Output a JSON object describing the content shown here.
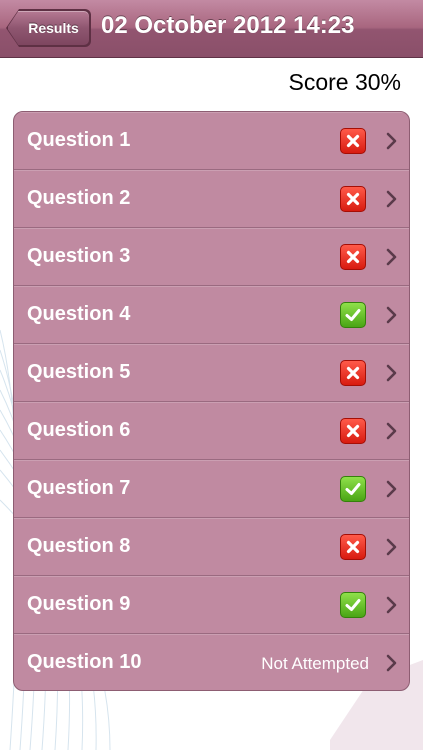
{
  "navbar": {
    "back_label": "Results",
    "title": "02 October 2012 14:23"
  },
  "score": {
    "text": "Score 30%"
  },
  "questions": [
    {
      "label": "Question 1",
      "status": "incorrect",
      "status_icon": "cross-icon",
      "status_text": ""
    },
    {
      "label": "Question 2",
      "status": "incorrect",
      "status_icon": "cross-icon",
      "status_text": ""
    },
    {
      "label": "Question 3",
      "status": "incorrect",
      "status_icon": "cross-icon",
      "status_text": ""
    },
    {
      "label": "Question 4",
      "status": "correct",
      "status_icon": "checkmark-icon",
      "status_text": ""
    },
    {
      "label": "Question 5",
      "status": "incorrect",
      "status_icon": "cross-icon",
      "status_text": ""
    },
    {
      "label": "Question 6",
      "status": "incorrect",
      "status_icon": "cross-icon",
      "status_text": ""
    },
    {
      "label": "Question 7",
      "status": "correct",
      "status_icon": "checkmark-icon",
      "status_text": ""
    },
    {
      "label": "Question 8",
      "status": "incorrect",
      "status_icon": "cross-icon",
      "status_text": ""
    },
    {
      "label": "Question 9",
      "status": "correct",
      "status_icon": "checkmark-icon",
      "status_text": ""
    },
    {
      "label": "Question 10",
      "status": "not_attempted",
      "status_icon": "",
      "status_text": "Not Attempted"
    }
  ],
  "colors": {
    "navbar": "#a8667f",
    "list_background": "#c08aa1",
    "incorrect": "#e0241a",
    "correct": "#5cb81e"
  }
}
